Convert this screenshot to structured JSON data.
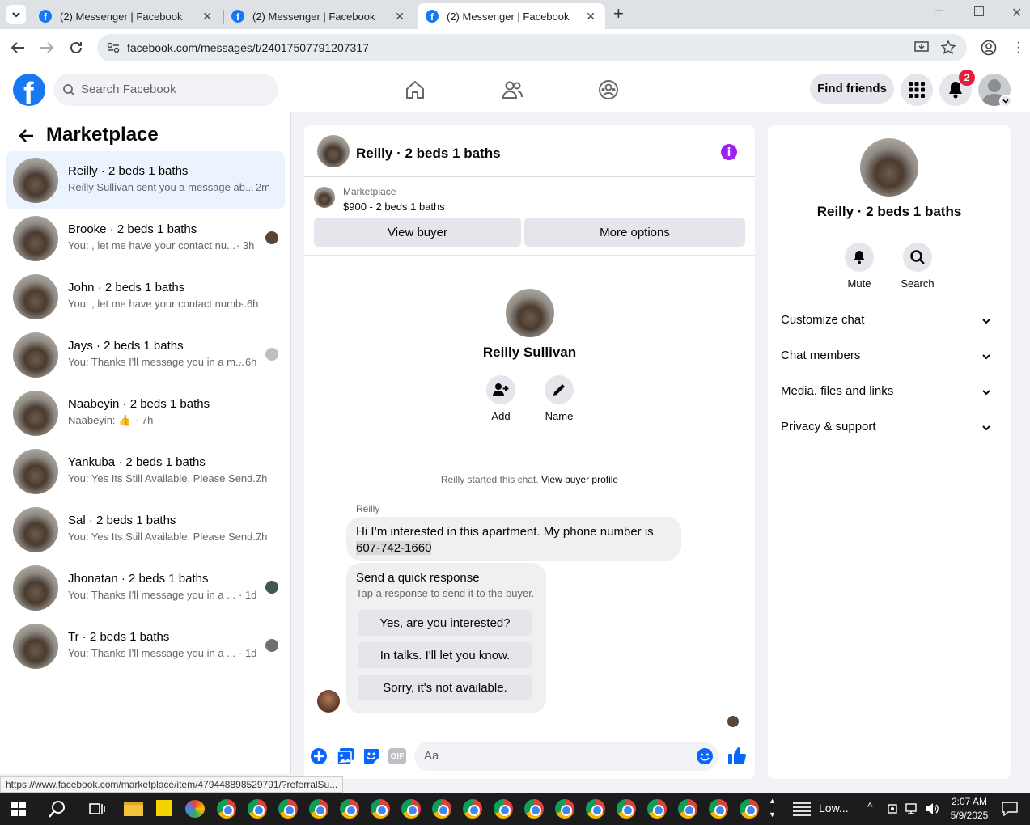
{
  "browser": {
    "tabs": [
      {
        "title": "(2) Messenger | Facebook"
      },
      {
        "title": "(2) Messenger | Facebook"
      },
      {
        "title": "(2) Messenger | Facebook"
      }
    ],
    "url": "facebook.com/messages/t/24017507791207317",
    "status_url": "https://www.facebook.com/marketplace/item/479448898529791/?referralSu..."
  },
  "fb_header": {
    "search_placeholder": "Search Facebook",
    "find_friends": "Find friends",
    "notification_count": "2"
  },
  "left": {
    "title": "Marketplace",
    "conversations": [
      {
        "name": "Reilly · 2 beds 1 baths",
        "preview": "Reilly Sullivan sent you a message ab...",
        "time": "· 2m"
      },
      {
        "name": "Brooke · 2 beds 1 baths",
        "preview": "You: , let me have your contact nu...",
        "time": "· 3h"
      },
      {
        "name": "John · 2 beds 1 baths",
        "preview": "You: , let me have your contact numb...",
        "time": "· 6h"
      },
      {
        "name": "Jays · 2 beds 1 baths",
        "preview": "You: Thanks I'll message you in a m...",
        "time": "· 6h"
      },
      {
        "name": "Naabeyin · 2 beds 1 baths",
        "preview": "Naabeyin: 👍",
        "time": "· 7h"
      },
      {
        "name": "Yankuba · 2 beds 1 baths",
        "preview": "You: Yes Its Still Available, Please Send...",
        "time": "· 7h"
      },
      {
        "name": "Sal · 2 beds 1 baths",
        "preview": "You: Yes Its Still Available, Please Send...",
        "time": "· 7h"
      },
      {
        "name": "Jhonatan · 2 beds 1 baths",
        "preview": "You: Thanks I'll message you in a ...",
        "time": "· 1d"
      },
      {
        "name": "Tr · 2 beds 1 baths",
        "preview": "You: Thanks I'll message you in a ...",
        "time": "· 1d"
      }
    ]
  },
  "chat": {
    "title": "Reilly · 2 beds 1 baths",
    "listing_source": "Marketplace",
    "listing_price": "$900 - 2 beds 1 baths",
    "view_buyer": "View buyer",
    "more_options": "More options",
    "profile_name": "Reilly Sullivan",
    "add_label": "Add",
    "name_label": "Name",
    "started_text": "Reilly started this chat.",
    "view_buyer_profile": "View buyer profile",
    "sender": "Reilly",
    "message_line1": "Hi I’m interested in this apartment. My phone number is",
    "message_phone": "607-742-1660",
    "quick_title": "Send a quick response",
    "quick_sub": "Tap a response to send it to the buyer.",
    "quick_responses": [
      "Yes, are you interested?",
      "In talks. I'll let you know.",
      "Sorry, it's not available."
    ],
    "composer_placeholder": "Aa"
  },
  "right": {
    "name": "Reilly · 2 beds 1 baths",
    "mute": "Mute",
    "search": "Search",
    "sections": [
      "Customize chat",
      "Chat members",
      "Media, files and links",
      "Privacy & support"
    ]
  },
  "taskbar": {
    "weather": "Low...",
    "time": "2:07 AM",
    "date": "5/9/2025"
  },
  "colors": {
    "brand": "#1877f2",
    "info": "#a020f0",
    "notif": "#e41e3f"
  }
}
